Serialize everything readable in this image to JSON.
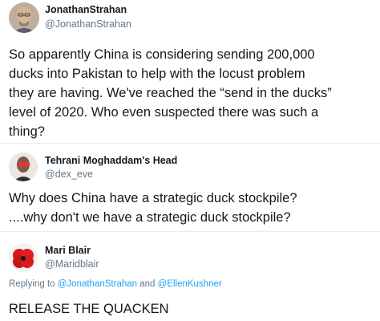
{
  "tweets": [
    {
      "author_name": "JonathanStrahan",
      "author_handle": "@JonathanStrahan",
      "text_lines": [
        "So apparently China is considering sending 200,000",
        "ducks into Pakistan to help with the locust problem",
        "they are having. We've reached the “send in the ducks”",
        "level of 2020. Who even suspected there was such a",
        "thing?"
      ]
    },
    {
      "author_name": "Tehrani Moghaddam's Head",
      "author_handle": "@dex_eve",
      "text_lines": [
        "Why does China have a strategic duck stockpile?",
        "....why don't we have a strategic duck stockpile?"
      ]
    },
    {
      "author_name": "Mari Blair",
      "author_handle": "@Maridblair",
      "replying": {
        "prefix": "Replying to",
        "mention_1": "@JonathanStrahan",
        "joiner": "and",
        "mention_2": "@EllenKushner"
      },
      "text_lines": [
        "RELEASE THE QUACKEN"
      ]
    }
  ],
  "colors": {
    "text": "#14171a",
    "secondary": "#657786",
    "link": "#1da1f2",
    "divider": "#e6ecf0"
  }
}
